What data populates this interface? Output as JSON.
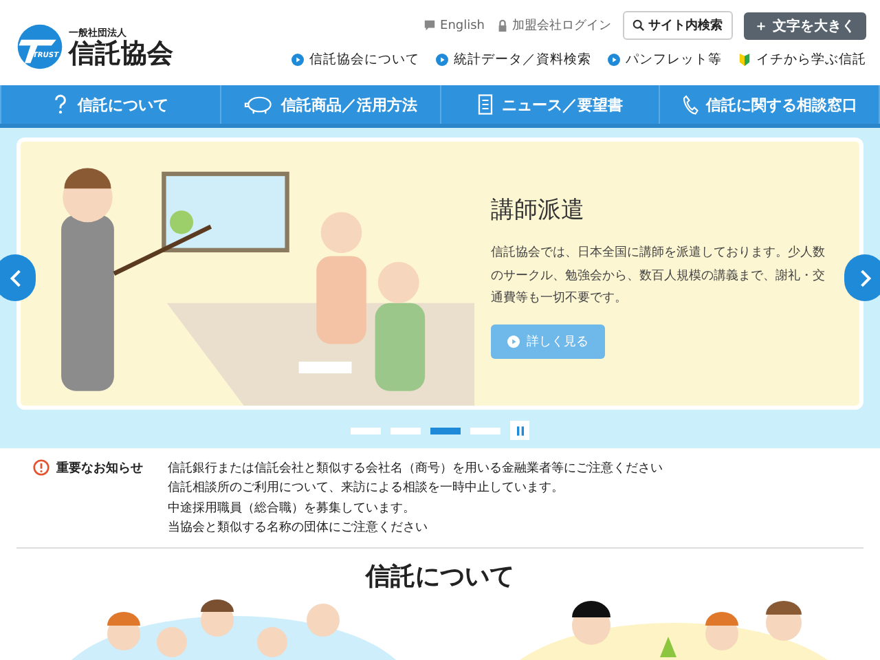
{
  "logo": {
    "subtitle": "一般社団法人",
    "title": "信託協会",
    "mark": "TRUST"
  },
  "utility_links": [
    {
      "label": "English",
      "kind": "speech"
    },
    {
      "label": "加盟会社ログイン",
      "kind": "lock"
    }
  ],
  "search_button": "サイト内検索",
  "text_size_button": "＋ 文字を大きく",
  "sub_links": [
    {
      "label": "信託協会について",
      "kind": "play"
    },
    {
      "label": "統計データ／資料検索",
      "kind": "play"
    },
    {
      "label": "パンフレット等",
      "kind": "play"
    },
    {
      "label": "イチから学ぶ信託",
      "kind": "leaf"
    }
  ],
  "main_nav": [
    {
      "label": "信託について",
      "kind": "question"
    },
    {
      "label": "信託商品／活用方法",
      "kind": "piggy"
    },
    {
      "label": "ニュース／要望書",
      "kind": "document"
    },
    {
      "label": "信託に関する相談窓口",
      "kind": "phone"
    }
  ],
  "slide": {
    "title": "講師派遣",
    "body": "信託協会では、日本全国に講師を派遣しております。少人数のサークル、勉強会から、数百人規模の講義まで、謝礼・交通費等も一切不要です。",
    "button": "詳しく見る"
  },
  "slide_dots": [
    {
      "selected": false
    },
    {
      "selected": false
    },
    {
      "selected": true
    },
    {
      "selected": false
    }
  ],
  "notice": {
    "label": "重要なお知らせ",
    "items": [
      "信託銀行または信託会社と類似する会社名（商号）を用いる金融業者等にご注意ください",
      "信託相談所のご利用について、来訪による相談を一時中止しています。",
      "中途採用職員（総合職）を募集しています。",
      "当協会と類似する名称の団体にご注意ください"
    ]
  },
  "section_heading": "信託について"
}
